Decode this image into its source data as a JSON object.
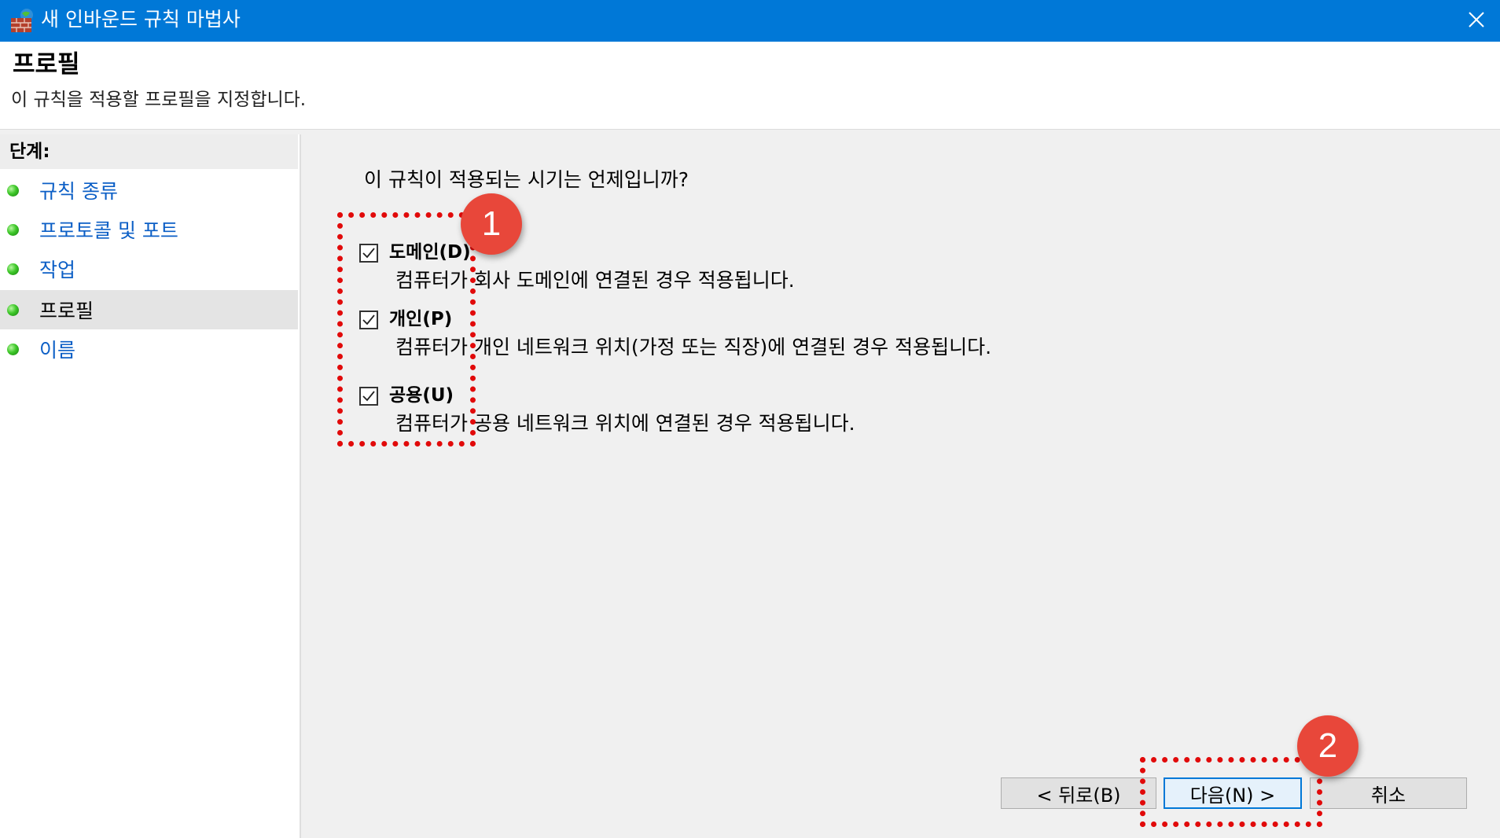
{
  "window": {
    "title": "새 인바운드 규칙 마법사",
    "app_icon": "firewall-brick-globe-icon",
    "close_icon": "close-icon"
  },
  "header": {
    "title": "프로필",
    "description": "이 규칙을 적용할 프로필을 지정합니다."
  },
  "sidebar": {
    "steps_title": "단계:",
    "items": [
      {
        "label": "규칙 종류",
        "active": false
      },
      {
        "label": "프로토콜 및 포트",
        "active": false
      },
      {
        "label": "작업",
        "active": false
      },
      {
        "label": "프로필",
        "active": true
      },
      {
        "label": "이름",
        "active": false
      }
    ]
  },
  "main": {
    "question": "이 규칙이 적용되는 시기는 언제입니까?",
    "profiles": [
      {
        "label": "도메인(D)",
        "checked": true,
        "description": "컴퓨터가 회사 도메인에 연결된 경우 적용됩니다."
      },
      {
        "label": "개인(P)",
        "checked": true,
        "description": "컴퓨터가 개인 네트워크 위치(가정 또는 직장)에 연결된 경우 적용됩니다."
      },
      {
        "label": "공용(U)",
        "checked": true,
        "description": "컴퓨터가 공용 네트워크 위치에 연결된 경우 적용됩니다."
      }
    ]
  },
  "buttons": {
    "back": "< 뒤로(B)",
    "next": "다음(N) >",
    "cancel": "취소"
  },
  "annotations": {
    "badge_1": "1",
    "badge_2": "2",
    "highlight_color": "#e10a0a",
    "badge_color": "#e8473a"
  },
  "colors": {
    "titlebar": "#0078d7",
    "link": "#0c5fc6",
    "step_dot": "#3fc82a"
  }
}
